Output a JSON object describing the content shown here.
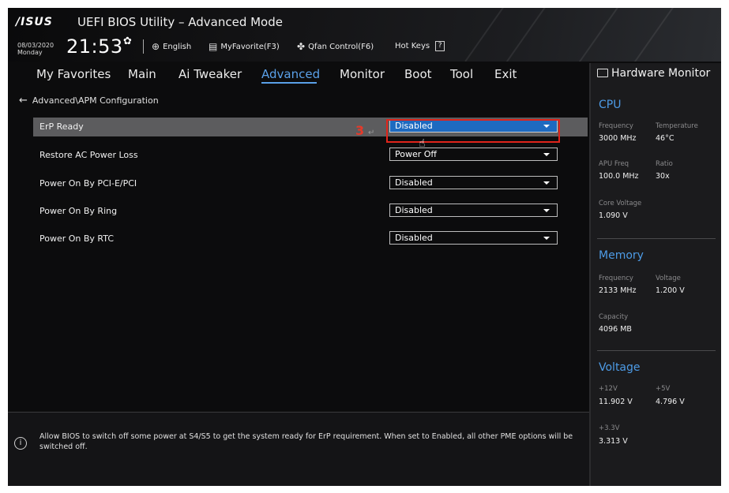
{
  "header": {
    "logo": "/ISUS",
    "title": "UEFI BIOS Utility – Advanced Mode",
    "date": "08/03/2020",
    "day": "Monday",
    "time": "21:53",
    "language": "English",
    "myfavorite": "MyFavorite(F3)",
    "qfan": "Qfan Control(F6)",
    "hotkeys": "Hot Keys",
    "hotkeys_key": "?"
  },
  "nav": {
    "tabs": [
      "My Favorites",
      "Main",
      "Ai Tweaker",
      "Advanced",
      "Monitor",
      "Boot",
      "Tool",
      "Exit"
    ],
    "active": "Advanced"
  },
  "breadcrumb": "Advanced\\APM Configuration",
  "settings": [
    {
      "label": "ErP Ready",
      "value": "Disabled"
    },
    {
      "label": "Restore AC Power Loss",
      "value": "Power Off"
    },
    {
      "label": "Power On By PCI-E/PCI",
      "value": "Disabled"
    },
    {
      "label": "Power On By Ring",
      "value": "Disabled"
    },
    {
      "label": "Power On By RTC",
      "value": "Disabled"
    }
  ],
  "annotation": {
    "step": "3"
  },
  "help": {
    "text": "Allow BIOS to switch off some power at S4/S5 to get the system ready for ErP requirement. When set to Enabled, all other PME options will be switched off."
  },
  "hardware_monitor": {
    "title": "Hardware Monitor",
    "cpu": {
      "heading": "CPU",
      "frequency_label": "Frequency",
      "frequency": "3000 MHz",
      "temperature_label": "Temperature",
      "temperature": "46°C",
      "apu_freq_label": "APU Freq",
      "apu_freq": "100.0 MHz",
      "ratio_label": "Ratio",
      "ratio": "30x",
      "core_voltage_label": "Core Voltage",
      "core_voltage": "1.090 V"
    },
    "memory": {
      "heading": "Memory",
      "frequency_label": "Frequency",
      "frequency": "2133 MHz",
      "voltage_label": "Voltage",
      "voltage": "1.200 V",
      "capacity_label": "Capacity",
      "capacity": "4096 MB"
    },
    "voltage": {
      "heading": "Voltage",
      "v12_label": "+12V",
      "v12": "11.902 V",
      "v5_label": "+5V",
      "v5": "4.796 V",
      "v33_label": "+3.3V",
      "v33": "3.313 V"
    }
  },
  "colors": {
    "accent": "#4d9be6",
    "selected": "#1e6ac0",
    "annotation": "#e0241b"
  }
}
